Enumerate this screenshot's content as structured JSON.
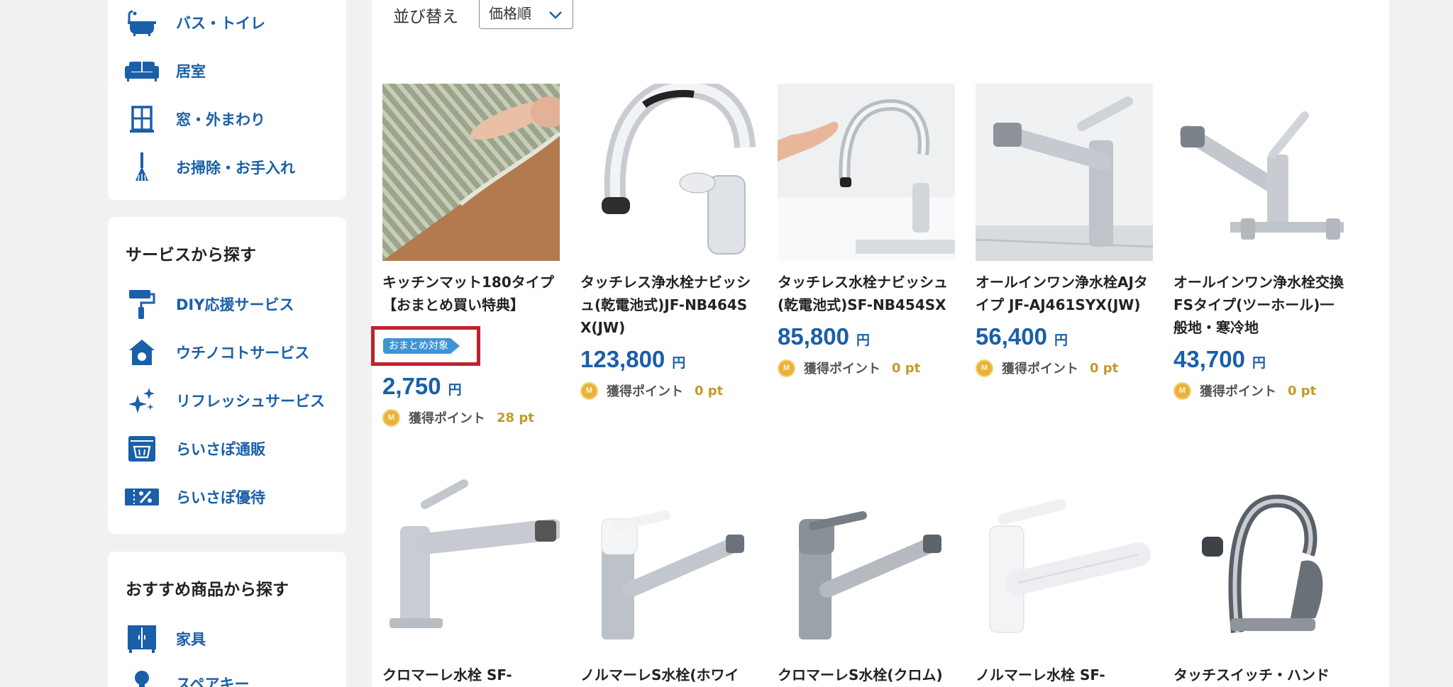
{
  "sidebar": {
    "categories": [
      {
        "label": "バス・トイレ",
        "icon": "bathtub-icon"
      },
      {
        "label": "居室",
        "icon": "sofa-icon"
      },
      {
        "label": "窓・外まわり",
        "icon": "window-icon"
      },
      {
        "label": "お掃除・お手入れ",
        "icon": "broom-icon"
      }
    ],
    "service_heading": "サービスから探す",
    "services": [
      {
        "label": "DIY応援サービス",
        "icon": "paint-roller-icon"
      },
      {
        "label": "ウチノコトサービス",
        "icon": "house-icon"
      },
      {
        "label": "リフレッシュサービス",
        "icon": "sparkle-icon"
      },
      {
        "label": "らいさぽ通販",
        "icon": "shopping-basket-icon"
      },
      {
        "label": "らいさぽ優待",
        "icon": "discount-ticket-icon"
      }
    ],
    "recommend_heading": "おすすめ商品から探す",
    "recommends": [
      {
        "label": "家具",
        "icon": "cabinet-icon"
      },
      {
        "label": "スペアキー",
        "icon": "key-icon"
      }
    ]
  },
  "sort": {
    "label": "並び替え",
    "selected": "価格順"
  },
  "products": [
    {
      "name": "キッチンマット180タイプ　【おまとめ買い特典】",
      "badge": "おまとめ対象",
      "price": "2,750",
      "yen": "円",
      "point_label": "獲得ポイント",
      "points": "28 pt",
      "image": "kitchen-mat"
    },
    {
      "name": "タッチレス浄水栓ナビッシュ(乾電池式)JF-NB464SX(JW)",
      "price": "123,800",
      "yen": "円",
      "point_label": "獲得ポイント",
      "points": "0 pt",
      "image": "touchless-faucet"
    },
    {
      "name": "タッチレス水栓ナビッシュ(乾電池式)SF-NB454SX",
      "price": "85,800",
      "yen": "円",
      "point_label": "獲得ポイント",
      "points": "0 pt",
      "image": "touchless-faucet-hand"
    },
    {
      "name": "オールインワン浄水栓AJタイプ JF-AJ461SYX(JW)",
      "price": "56,400",
      "yen": "円",
      "point_label": "獲得ポイント",
      "points": "0 pt",
      "image": "allinone-faucet"
    },
    {
      "name": "オールインワン浄水栓交換　FSタイプ(ツーホール)一般地・寒冷地",
      "price": "43,700",
      "yen": "円",
      "point_label": "獲得ポイント",
      "points": "0 pt",
      "image": "two-hole-faucet"
    },
    {
      "name": "クロマーレ水栓 SF-",
      "image": "pullout-faucet-chrome"
    },
    {
      "name": "ノルマーレS水栓(ホワイ",
      "image": "faucet-white-base"
    },
    {
      "name": "クロマーレS水栓(クロム)",
      "image": "faucet-chrome"
    },
    {
      "name": "ノルマーレ水栓 SF-",
      "image": "faucet-white"
    },
    {
      "name": "タッチスイッチ・ハンド",
      "image": "touch-switch-faucet"
    }
  ]
}
